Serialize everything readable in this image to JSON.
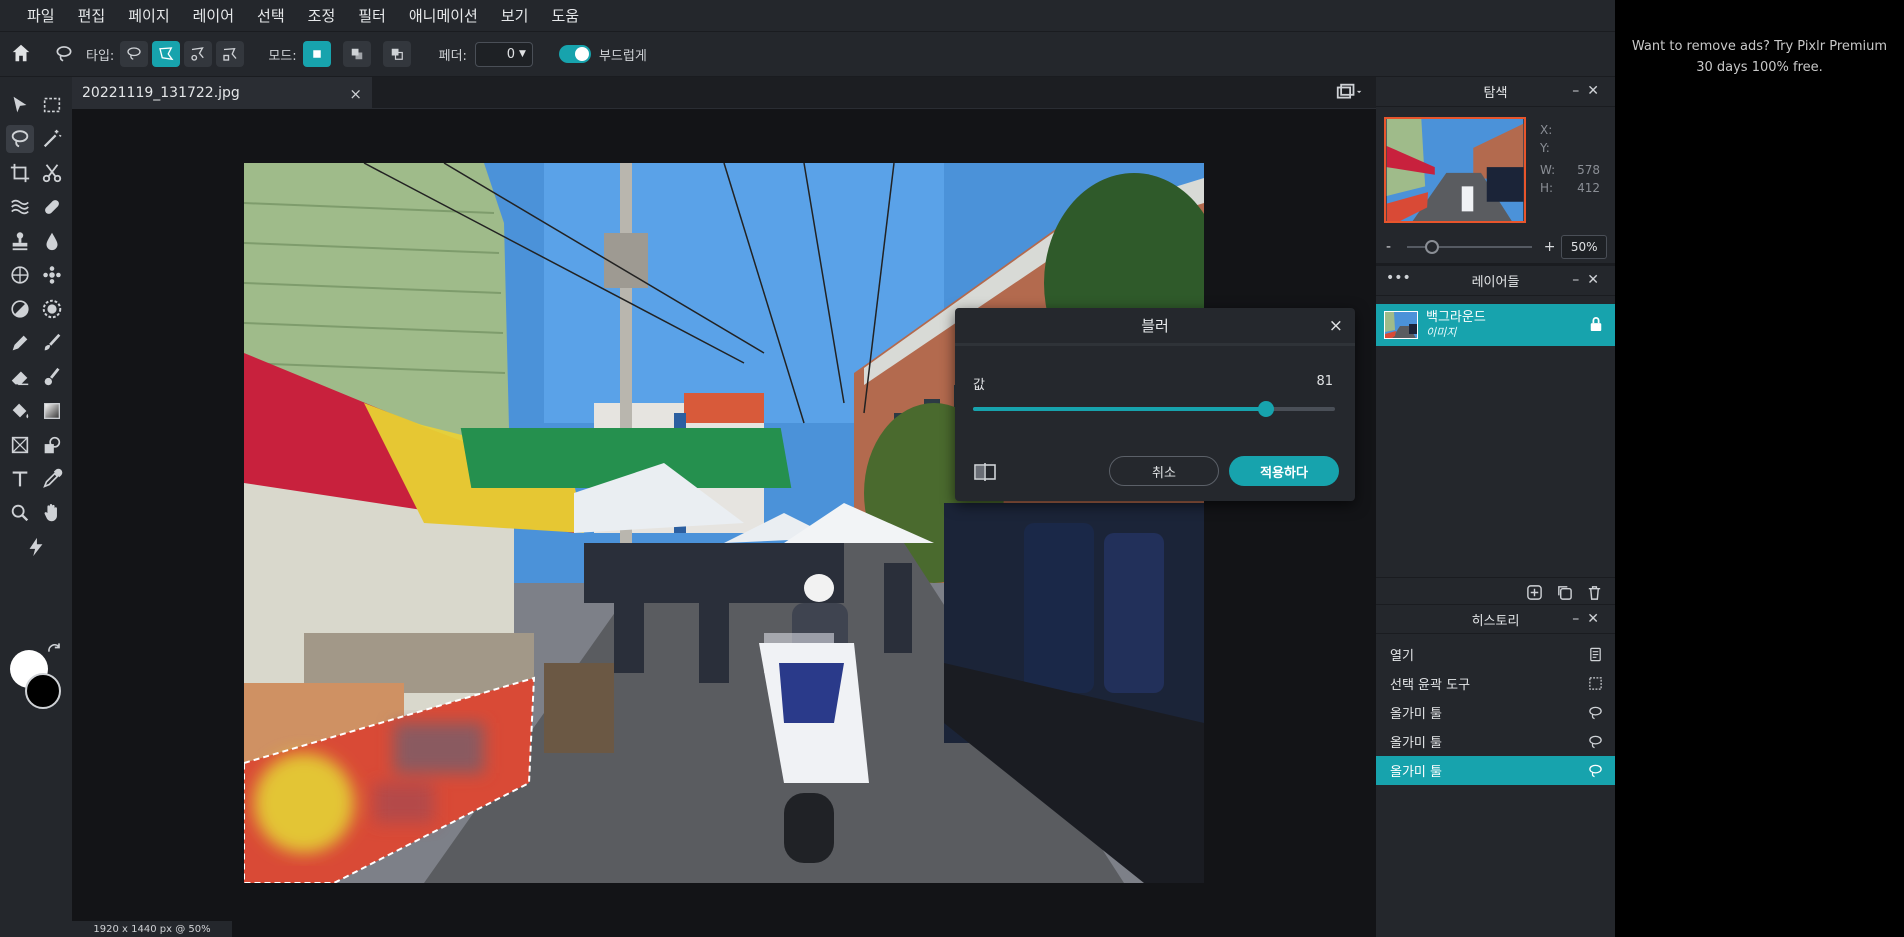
{
  "menu": [
    "파일",
    "편집",
    "페이지",
    "레이어",
    "선택",
    "조정",
    "필터",
    "애니메이션",
    "보기",
    "도움"
  ],
  "options": {
    "type_label": "타입:",
    "mode_label": "모드:",
    "feather_label": "페더:",
    "feather_value": "0",
    "smooth_label": "부드럽게"
  },
  "document": {
    "tab_name": "20221119_131722.jpg",
    "close": "×",
    "status": "1920 x 1440 px @ 50%"
  },
  "blur_dialog": {
    "title": "블러",
    "close": "×",
    "value_label": "값",
    "value": 81,
    "value_fraction": 0.81,
    "cancel": "취소",
    "apply": "적용하다"
  },
  "navigator": {
    "title": "탐색",
    "x_label": "X:",
    "y_label": "Y:",
    "w_label": "W:",
    "h_label": "H:",
    "x_value": "",
    "y_value": "",
    "w_value": "578",
    "h_value": "412",
    "zoom_minus": "-",
    "zoom_plus": "+",
    "zoom": "50%"
  },
  "layers": {
    "title": "레이어들",
    "items": [
      {
        "name": "백그라운드",
        "type": "이미지"
      }
    ]
  },
  "history": {
    "title": "히스토리",
    "items": [
      {
        "label": "열기",
        "icon": "document-icon"
      },
      {
        "label": "선택 윤곽 도구",
        "icon": "marquee-icon"
      },
      {
        "label": "올가미 툴",
        "icon": "lasso-icon"
      },
      {
        "label": "올가미 툴",
        "icon": "lasso-icon"
      },
      {
        "label": "올가미 툴",
        "icon": "lasso-icon",
        "selected": true
      }
    ]
  },
  "ad": {
    "line1": "Want to remove ads? Try Pixlr Premium",
    "line2": "30 days 100% free."
  },
  "colors": {
    "accent": "#17a3ad",
    "foreground_color": "#ffffff",
    "background_color": "#000000"
  }
}
